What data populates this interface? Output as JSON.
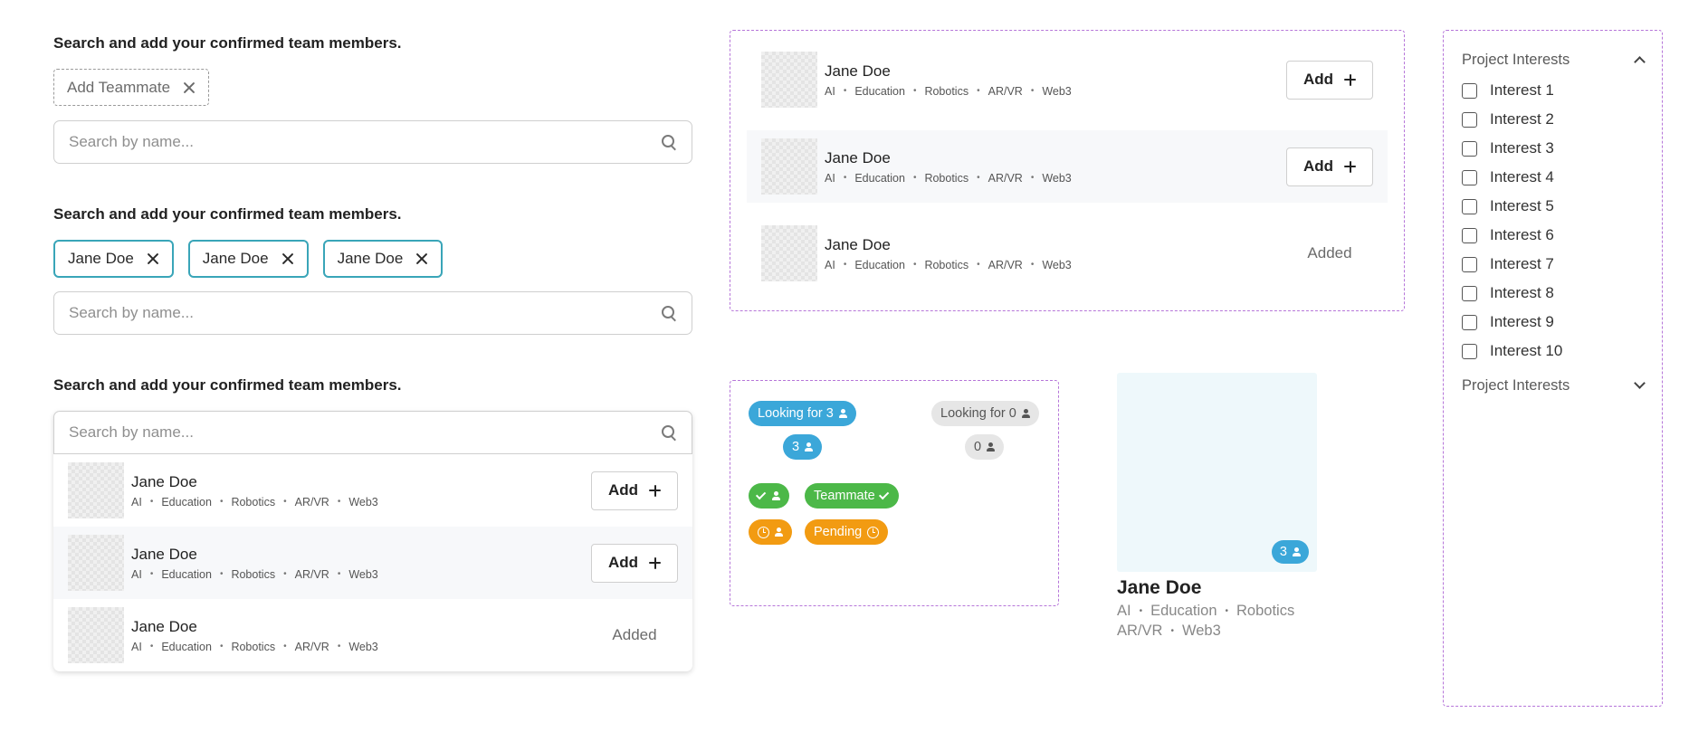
{
  "section1": {
    "heading": "Search and add your confirmed team members.",
    "add_chip": "Add Teammate",
    "search_placeholder": "Search by name..."
  },
  "section2": {
    "heading": "Search and add your confirmed team members.",
    "chips": [
      "Jane Doe",
      "Jane Doe",
      "Jane Doe"
    ],
    "search_placeholder": "Search by name..."
  },
  "section3": {
    "heading": "Search and add your confirmed team members.",
    "search_placeholder": "Search by name..."
  },
  "person": {
    "name": "Jane Doe",
    "tags": [
      "AI",
      "Education",
      "Robotics",
      "AR/VR",
      "Web3"
    ]
  },
  "list_rows": [
    {
      "name": "Jane Doe",
      "state": "add",
      "action_label": "Add"
    },
    {
      "name": "Jane Doe",
      "state": "add",
      "action_label": "Add"
    },
    {
      "name": "Jane Doe",
      "state": "added",
      "action_label": "Added"
    }
  ],
  "badges": {
    "looking_for_3": "Looking for 3",
    "looking_for_0": "Looking for 0",
    "count_3": "3",
    "count_0": "0",
    "teammate": "Teammate",
    "pending": "Pending"
  },
  "card": {
    "name": "Jane Doe",
    "tags_line1": [
      "AI",
      "Education",
      "Robotics"
    ],
    "tags_line2": [
      "AR/VR",
      "Web3"
    ],
    "badge_count": "3"
  },
  "filters": {
    "group1_title": "Project Interests",
    "interests": [
      "Interest 1",
      "Interest 2",
      "Interest 3",
      "Interest 4",
      "Interest 5",
      "Interest 6",
      "Interest 7",
      "Interest 8",
      "Interest 9",
      "Interest 10"
    ],
    "group2_title": "Project Interests"
  },
  "colors": {
    "teal": "#39a5b8",
    "blue": "#3ba7d9",
    "green": "#4cb848",
    "orange": "#f29b12",
    "purple_dashed": "#b676d9",
    "card_bg": "#eef8fb"
  }
}
